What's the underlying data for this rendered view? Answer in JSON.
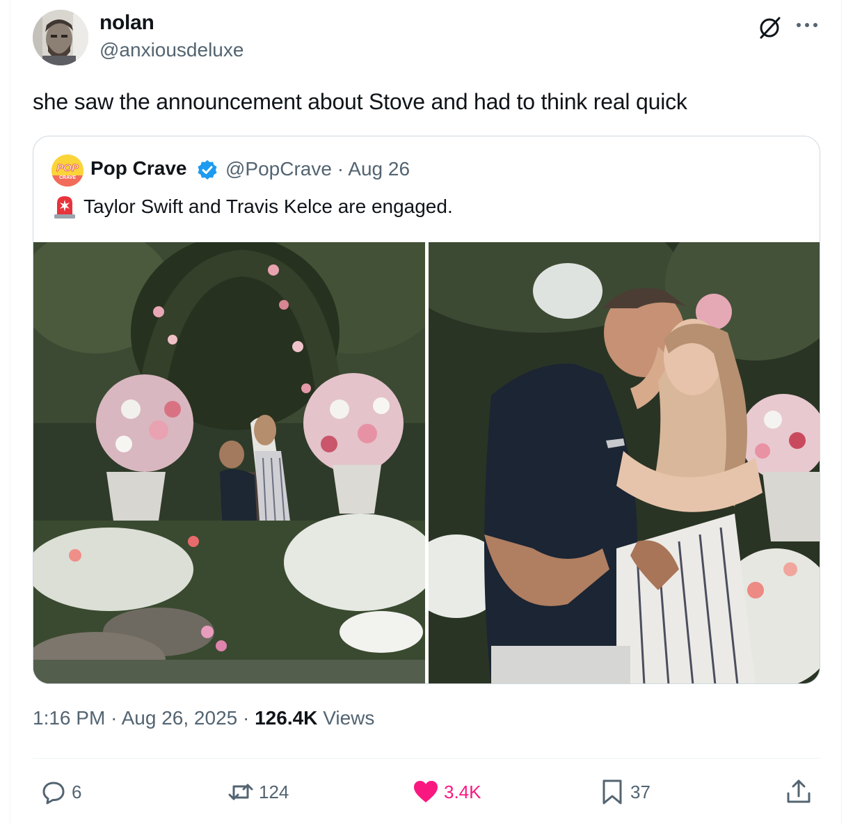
{
  "author": {
    "name": "nolan",
    "handle": "@anxiousdeluxe"
  },
  "tweet": {
    "text": "she saw the announcement about Stove and had to think real quick"
  },
  "quote": {
    "avatar_text_top": "POP",
    "avatar_text_bottom": "CRAVE",
    "name": "Pop Crave",
    "handle": "@PopCrave",
    "separator": "·",
    "date": "Aug 26",
    "text": "Taylor Swift and Travis Kelce are engaged.",
    "siren_icon": "police-siren-emoji"
  },
  "meta": {
    "time": "1:16 PM",
    "separator": "·",
    "date": "Aug 26, 2025",
    "views_count": "126.4K",
    "views_label": "Views"
  },
  "actions": {
    "replies": "6",
    "reposts": "124",
    "likes": "3.4K",
    "bookmarks": "37"
  },
  "colors": {
    "text_primary": "#0f1419",
    "text_secondary": "#536471",
    "verified": "#1d9bf0",
    "like": "#f91880",
    "border": "#cfd9de"
  }
}
